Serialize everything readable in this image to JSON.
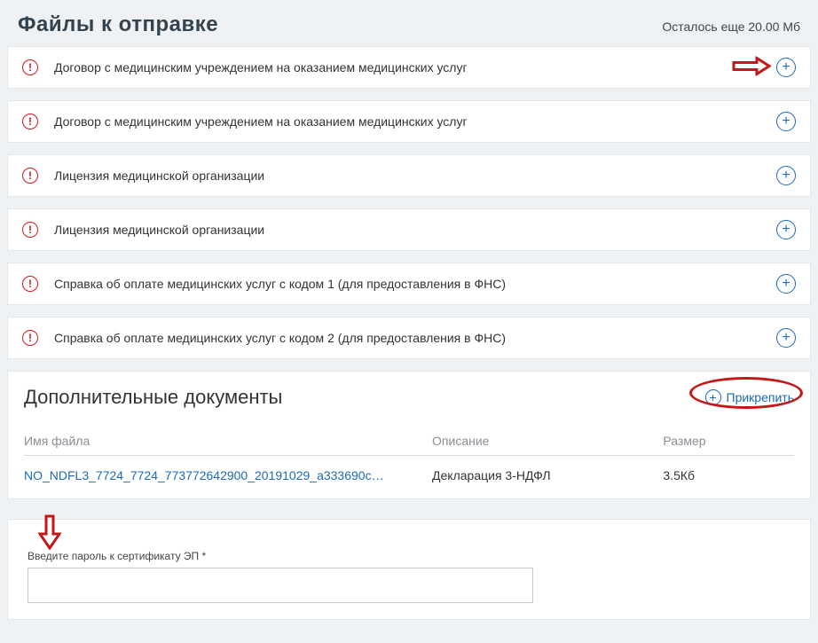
{
  "header": {
    "title": "Файлы к отправке",
    "remaining": "Осталось еще 20.00 Мб"
  },
  "file_rows": [
    {
      "label": "Договор с медицинским учреждением на оказанием медицинских услуг"
    },
    {
      "label": "Договор с медицинским учреждением на оказанием медицинских услуг"
    },
    {
      "label": "Лицензия медицинской организации"
    },
    {
      "label": "Лицензия медицинской организации"
    },
    {
      "label": "Справка об оплате медицинских услуг с кодом 1 (для предоставления в ФНС)"
    },
    {
      "label": "Справка об оплате медицинских услуг с кодом 2 (для предоставления в ФНС)"
    }
  ],
  "additional": {
    "title": "Дополнительные документы",
    "attach_label": "Прикрепить",
    "columns": {
      "name": "Имя файла",
      "desc": "Описание",
      "size": "Размер"
    },
    "rows": [
      {
        "name": "NO_NDFL3_7724_7724_773772642900_20191029_a333690c…",
        "desc": "Декларация 3-НДФЛ",
        "size": "3.5Кб"
      }
    ]
  },
  "password": {
    "label": "Введите пароль к сертификату ЭП *",
    "value": ""
  }
}
